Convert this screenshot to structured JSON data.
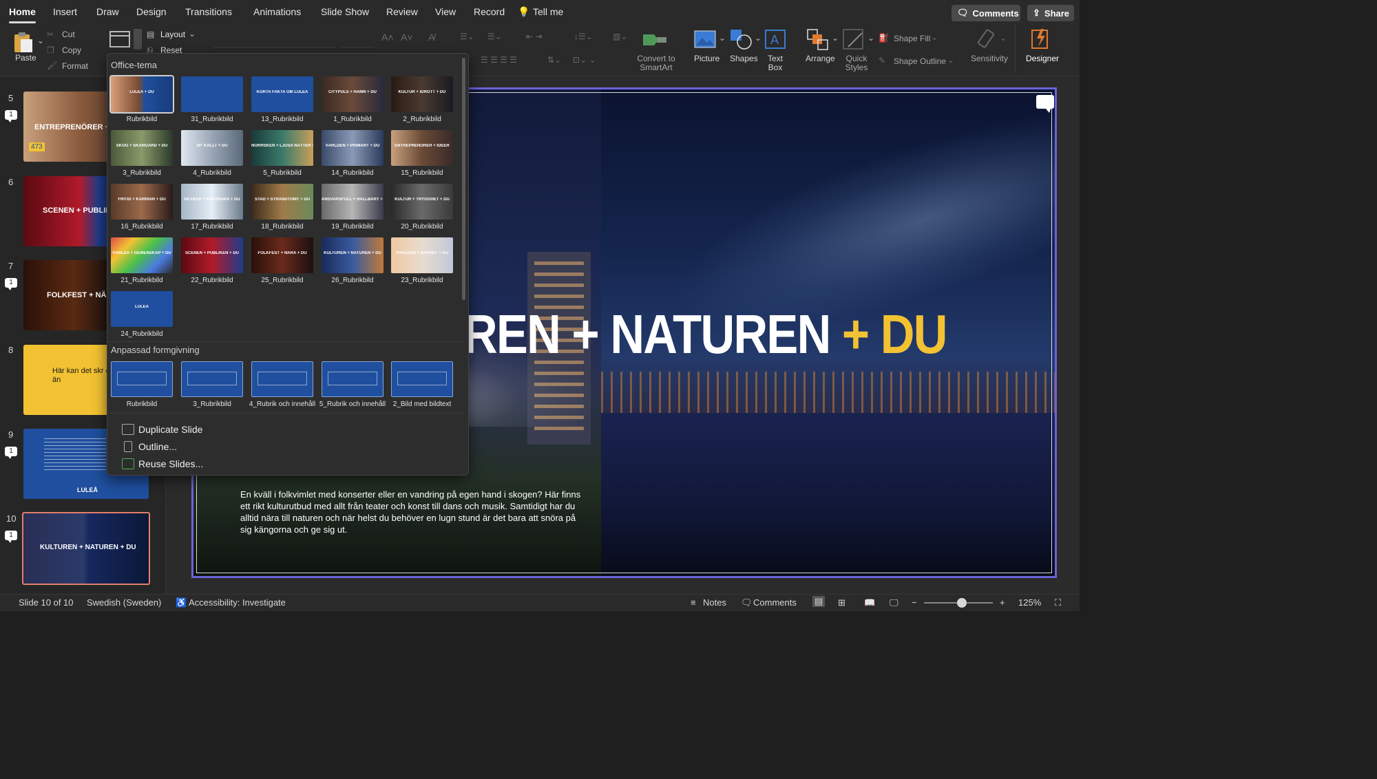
{
  "ribbon_tabs": [
    "Home",
    "Insert",
    "Draw",
    "Design",
    "Transitions",
    "Animations",
    "Slide Show",
    "Review",
    "View",
    "Record"
  ],
  "tell_me": "Tell me",
  "header_buttons": {
    "comments": "Comments",
    "share": "Share"
  },
  "clipboard": {
    "paste": "Paste",
    "cut": "Cut",
    "copy": "Copy",
    "format": "Format"
  },
  "slides_group": {
    "layout": "Layout",
    "reset": "Reset"
  },
  "ribbon_right": {
    "convert_smartart": "Convert to SmartArt",
    "picture": "Picture",
    "shapes": "Shapes",
    "text_box": "Text Box",
    "arrange": "Arrange",
    "quick_styles": "Quick Styles",
    "shape_fill": "Shape Fill",
    "shape_outline": "Shape Outline",
    "sensitivity": "Sensitivity",
    "designer": "Designer"
  },
  "slides_pane": [
    {
      "number": "5",
      "text": "ENTREPRENÖRER + ID",
      "badge": "473",
      "comments": "1"
    },
    {
      "number": "6",
      "text": "SCENEN + PUBLIKE",
      "comments": ""
    },
    {
      "number": "7",
      "text": "FOLKFEST + NÄRA",
      "comments": "1"
    },
    {
      "number": "8",
      "text": "Här kan det skr en rubrik om än",
      "comments": ""
    },
    {
      "number": "9",
      "text": "LULEÅ",
      "comments": "1"
    },
    {
      "number": "10",
      "text": "KULTUREN + NATUREN + DU",
      "comments": "1"
    }
  ],
  "layout_dropdown": {
    "section_office": "Office-tema",
    "office_layouts": [
      {
        "name": "Rubrikbild",
        "thumb": "LULEÅ + DU"
      },
      {
        "name": "31_Rubrikbild",
        "thumb": ""
      },
      {
        "name": "13_Rubrikbild",
        "thumb": "KORTA FAKTA OM LULEÅ"
      },
      {
        "name": "1_Rubrikbild",
        "thumb": "CITYPULS + HAMN + DU"
      },
      {
        "name": "2_Rubrikbild",
        "thumb": "KULTUR + IDROTT + DU"
      },
      {
        "name": "3_Rubrikbild",
        "thumb": "SKOG + SKÄRGÅRD + DU"
      },
      {
        "name": "4_Rubrikbild",
        "thumb": "30° KALLT + DU"
      },
      {
        "name": "5_Rubrikbild",
        "thumb": "NORRSKEN + LJUSA NÄTTER + DU"
      },
      {
        "name": "14_Rubrikbild",
        "thumb": "VÄRLDEN + PRIMÄRT + DU"
      },
      {
        "name": "15_Rubrikbild",
        "thumb": "ENTREPRENÖRER + IDÉER"
      },
      {
        "name": "16_Rubrikbild",
        "thumb": "FRITID + KARRIÄR + DU"
      },
      {
        "name": "17_Rubrikbild",
        "thumb": "SKYBAR + KOSTNÄRA + DU"
      },
      {
        "name": "18_Rubrikbild",
        "thumb": "STAD + STRANDTOMT + DU"
      },
      {
        "name": "19_Rubrikbild",
        "thumb": "ANSVARSFULL + HÅLLBART + DU"
      },
      {
        "name": "20_Rubrikbild",
        "thumb": "KULTUR + TRYGGHET + DU"
      },
      {
        "name": "21_Rubrikbild",
        "thumb": "VÄRLDA + GEMENSKAP + DU"
      },
      {
        "name": "22_Rubrikbild",
        "thumb": "SCENEN + PUBLIKEN + DU"
      },
      {
        "name": "25_Rubrikbild",
        "thumb": "FOLKFEST + NÄRA + DU"
      },
      {
        "name": "26_Rubrikbild",
        "thumb": "KULTUREN + NATUREN + DU"
      },
      {
        "name": "23_Rubrikbild",
        "thumb": "VÄRLDEN + NÄRHET + DU"
      },
      {
        "name": "24_Rubrikbild",
        "thumb": "LULEÅ"
      }
    ],
    "section_custom": "Anpassad formgivning",
    "custom_layouts": [
      {
        "name": "Rubrikbild"
      },
      {
        "name": "3_Rubrikbild"
      },
      {
        "name": "4_Rubrik och innehåll"
      },
      {
        "name": "5_Rubrik och innehåll"
      },
      {
        "name": "2_Bild med bildtext"
      }
    ],
    "menu": [
      "Duplicate Slide",
      "Outline...",
      "Reuse Slides..."
    ]
  },
  "slide": {
    "title_part1": "REN + NATUREN",
    "title_plus": " + ",
    "title_du": "DU",
    "body": "En kväll i folkvimlet med konserter eller en vandring på egen hand i skogen? Här finns ett rikt kulturutbud med allt från teater och konst till dans och musik. Samtidigt har du alltid nära till naturen och när helst du behöver en lugn stund är det bara att snöra på sig kängorna och ge sig ut."
  },
  "status_bar": {
    "slide_pos": "Slide 10 of 10",
    "language": "Swedish (Sweden)",
    "accessibility": "Accessibility: Investigate",
    "notes": "Notes",
    "comments": "Comments",
    "zoom": "125%",
    "zoom_level_percent": 125
  },
  "colors": {
    "accent_yellow": "#f2c233",
    "selection_purple": "#6b63d9",
    "luleaa_blue": "#1f4f9e"
  }
}
